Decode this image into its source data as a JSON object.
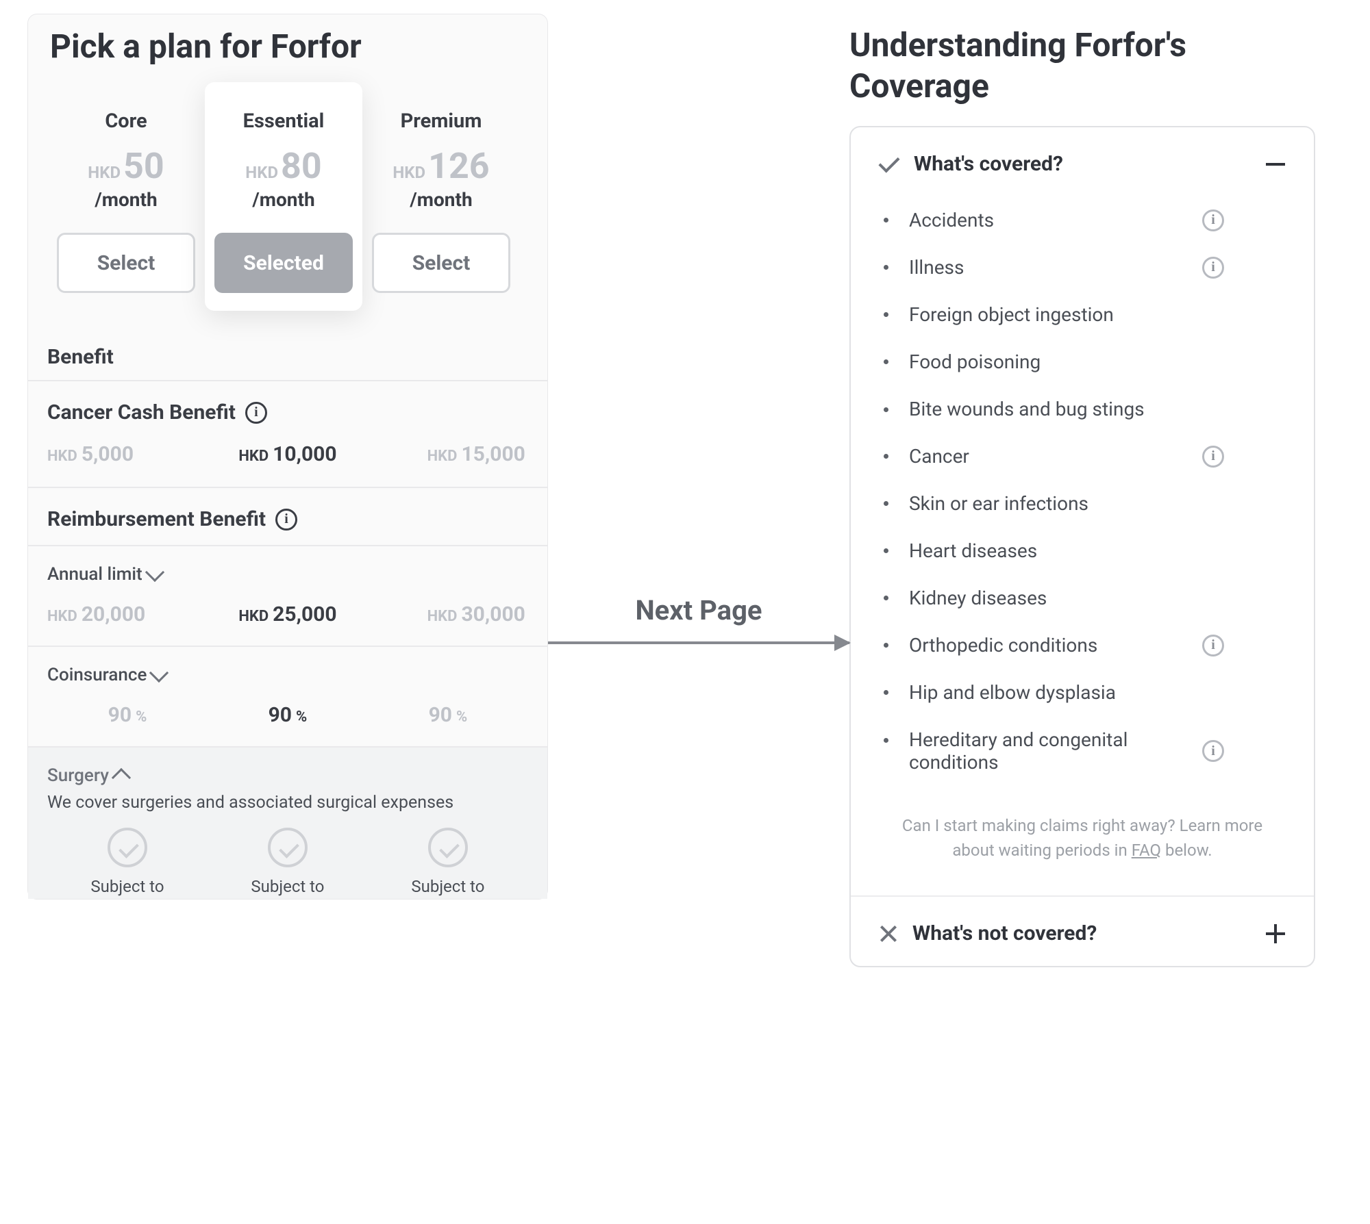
{
  "left": {
    "title": "Pick a plan for Forfor",
    "plans": [
      {
        "name": "Core",
        "currency": "HKD",
        "price": "50",
        "period": "/month",
        "button": "Select",
        "selected": false
      },
      {
        "name": "Essential",
        "currency": "HKD",
        "price": "80",
        "period": "/month",
        "button": "Selected",
        "selected": true
      },
      {
        "name": "Premium",
        "currency": "HKD",
        "price": "126",
        "period": "/month",
        "button": "Select",
        "selected": false
      }
    ],
    "benefit_heading": "Benefit",
    "cancer": {
      "title": "Cancer Cash Benefit",
      "values": [
        {
          "currency": "HKD",
          "amount": "5,000",
          "active": false
        },
        {
          "currency": "HKD",
          "amount": "10,000",
          "active": true
        },
        {
          "currency": "HKD",
          "amount": "15,000",
          "active": false
        }
      ]
    },
    "reimb_title": "Reimbursement Benefit",
    "annual": {
      "title": "Annual limit",
      "values": [
        {
          "currency": "HKD",
          "amount": "20,000",
          "active": false
        },
        {
          "currency": "HKD",
          "amount": "25,000",
          "active": true
        },
        {
          "currency": "HKD",
          "amount": "30,000",
          "active": false
        }
      ]
    },
    "coins": {
      "title": "Coinsurance",
      "values": [
        {
          "amount": "90",
          "unit": "%",
          "active": false
        },
        {
          "amount": "90",
          "unit": "%",
          "active": true
        },
        {
          "amount": "90",
          "unit": "%",
          "active": false
        }
      ]
    },
    "surgery": {
      "title": "Surgery",
      "desc": "We cover surgeries and associated surgical expenses",
      "subject": "Subject to"
    }
  },
  "mid": {
    "label": "Next Page"
  },
  "right": {
    "title_line1": "Understanding Forfor's",
    "title_line2": "Coverage",
    "covered_title": "What's covered?",
    "items": [
      {
        "label": "Accidents",
        "info": true,
        "wrap": false
      },
      {
        "label": "Illness",
        "info": true,
        "wrap": false
      },
      {
        "label": "Foreign object ingestion",
        "info": false,
        "wrap": false
      },
      {
        "label": "Food poisoning",
        "info": false,
        "wrap": false
      },
      {
        "label": "Bite wounds and bug stings",
        "info": false,
        "wrap": true
      },
      {
        "label": "Cancer",
        "info": true,
        "wrap": false
      },
      {
        "label": "Skin or ear infections",
        "info": false,
        "wrap": false
      },
      {
        "label": "Heart diseases",
        "info": false,
        "wrap": false
      },
      {
        "label": "Kidney diseases",
        "info": false,
        "wrap": false
      },
      {
        "label": "Orthopedic conditions",
        "info": true,
        "wrap": false
      },
      {
        "label": "Hip and elbow dysplasia",
        "info": false,
        "wrap": false
      },
      {
        "label": "Hereditary and congenital conditions",
        "info": true,
        "wrap": true
      }
    ],
    "faq_pre": "Can I start making claims right away? Learn more about waiting periods in ",
    "faq_link": "FAQ",
    "faq_post": " below.",
    "not_title": "What's not covered?"
  }
}
